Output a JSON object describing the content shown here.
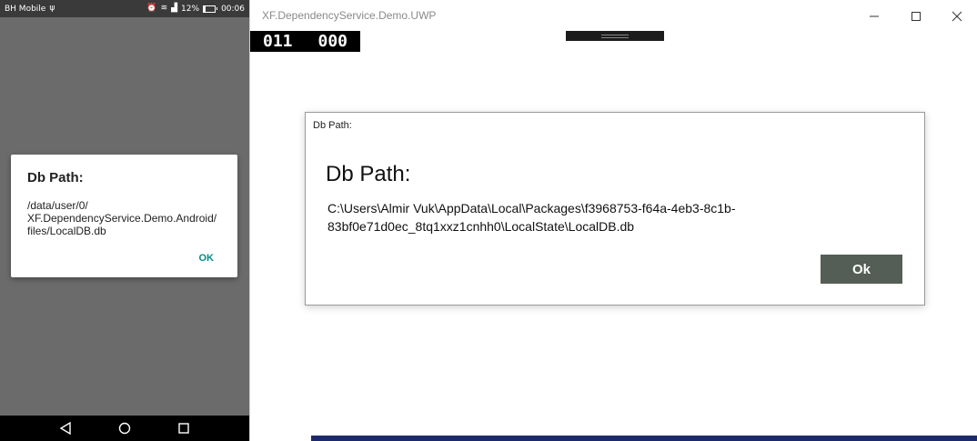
{
  "android": {
    "status": {
      "carrier": "BH Mobile",
      "battery": "12%",
      "time": "00:06"
    },
    "dialog": {
      "title": "Db Path:",
      "message": "/data/user/0/\nXF.DependencyService.Demo.Android/\nfiles/LocalDB.db",
      "ok_label": "OK"
    },
    "nav": [
      "back-icon",
      "home-icon",
      "recents-icon"
    ]
  },
  "uwp": {
    "title": "XF.DependencyService.Demo.UWP",
    "frame_counter": [
      "011",
      "000"
    ],
    "dialog": {
      "window_title": "Db Path:",
      "heading": "Db Path:",
      "path": "C:\\Users\\Almir Vuk\\AppData\\Local\\Packages\\f3968753-f64a-4eb3-8c1b-83bf0e71d0ec_8tq1xxz1cnhh0\\LocalState\\LocalDB.db",
      "ok_label": "Ok"
    }
  },
  "colors": {
    "ok_button": "#545e56",
    "android_accent": "#088a8a"
  }
}
